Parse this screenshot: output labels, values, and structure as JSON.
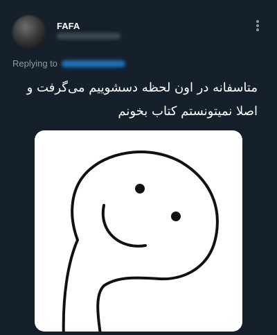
{
  "author": {
    "display_name": "FAFA"
  },
  "reply": {
    "label": "Replying to"
  },
  "tweet": {
    "text_line1": "متاسفانه در اون لحظه دسشوییم می‌گرفت و",
    "text_line2": "اصلا نمیتونستم کتاب بخونم"
  },
  "icons": {
    "more": "more-vertical-icon"
  },
  "colors": {
    "background": "#15202b",
    "secondary_text": "#8b98a5"
  }
}
